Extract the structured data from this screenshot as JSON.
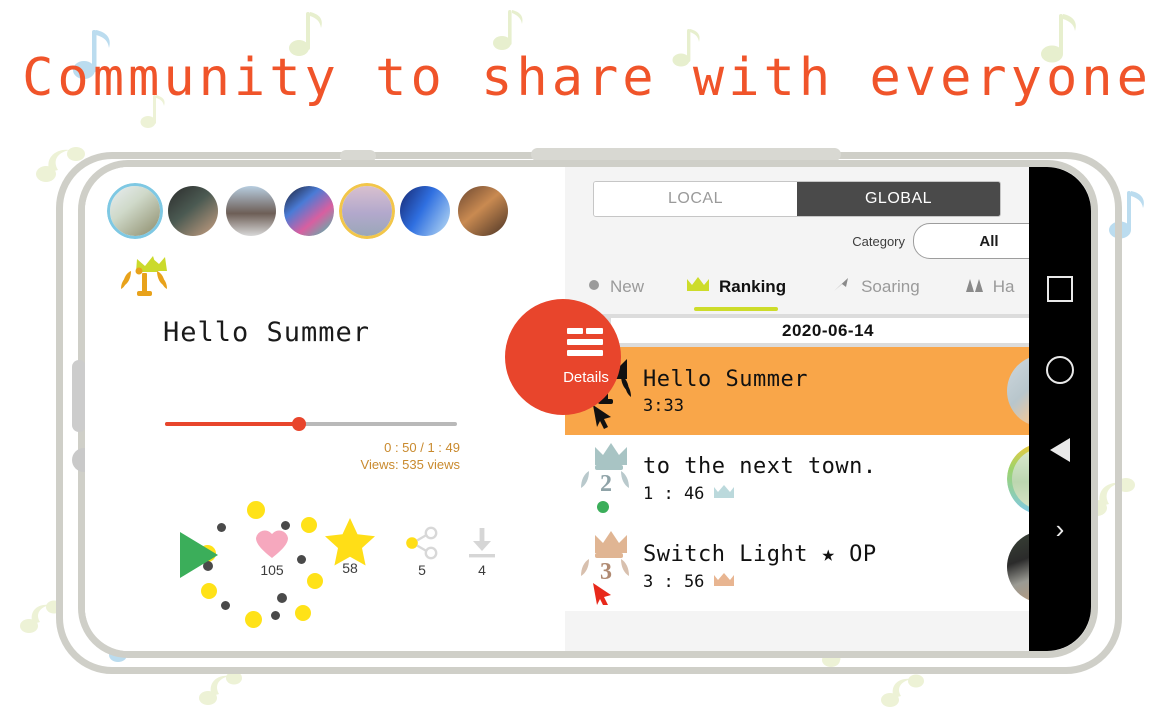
{
  "headline": "Community to share with everyone",
  "theme": {
    "accent_orange": "#F0542A",
    "accent_red": "#E8452C",
    "selected_row": "#F9A649",
    "tab_active_underline": "#CDDC2A",
    "date_button": "#CBD92B",
    "play_green": "#3BAE5A",
    "time_text": "#C98A2E",
    "phone_frame": "#cfcfc8"
  },
  "player": {
    "title": "Hello Summer",
    "progress_percent": 46,
    "time": "0 : 50 / 1 : 49",
    "views": "Views:  535 views",
    "play_icon": "play-triangle-icon",
    "trophy_icon": "crown-laurel-icon",
    "stats": [
      {
        "icon": "heart-icon",
        "count": "105"
      },
      {
        "icon": "star-icon",
        "count": "58"
      },
      {
        "icon": "share-icon",
        "count": "5"
      },
      {
        "icon": "download-icon",
        "count": "4"
      }
    ],
    "stories": [
      {
        "name": "story-avatar-1"
      },
      {
        "name": "story-avatar-2"
      },
      {
        "name": "story-avatar-3"
      },
      {
        "name": "story-avatar-4"
      },
      {
        "name": "story-avatar-5"
      },
      {
        "name": "story-avatar-6"
      },
      {
        "name": "story-avatar-7"
      }
    ]
  },
  "community": {
    "scope_toggle": {
      "local": "LOCAL",
      "global": "GLOBAL",
      "selected": "GLOBAL"
    },
    "category": {
      "label": "Category",
      "value": "All"
    },
    "tabs": [
      {
        "label": "New",
        "icon": "dot-icon",
        "active": false
      },
      {
        "label": "Ranking",
        "icon": "crown-icon",
        "active": true
      },
      {
        "label": "Soaring",
        "icon": "arrow-up-right-icon",
        "active": false
      },
      {
        "label": "Ha",
        "icon": "mountain-icon",
        "active": false
      }
    ],
    "date": {
      "value": "2020-06-14",
      "prev_icon": "prev-day-button",
      "next_icon": "next-day-button"
    },
    "details_button": {
      "label": "Details",
      "icon": "list-lines-icon"
    },
    "rows": [
      {
        "rank": "1",
        "title": "Hello Summer",
        "duration": "3:33",
        "selected": true,
        "badge_icon": "rank1-crown-laurel-icon",
        "cursor_icon": "cursor-arrow-icon",
        "thumb": "thumb-avatar-1"
      },
      {
        "rank": "2",
        "title": "to the next town.",
        "duration": "1 : 46",
        "selected": false,
        "badge_icon": "rank2-crown-laurel-icon",
        "crown_icon": "crown-small-icon",
        "status_icon": "green-dot-icon",
        "thumb": "thumb-avatar-2"
      },
      {
        "rank": "3",
        "title": "Switch Light ★ OP",
        "duration": "3 : 56",
        "selected": false,
        "badge_icon": "rank3-crown-laurel-icon",
        "crown_icon": "crown-small-icon",
        "cursor_icon": "red-cursor-arrow-icon",
        "thumb": "thumb-avatar-3"
      }
    ]
  },
  "android_nav": {
    "recents": "recents-square-icon",
    "home": "home-circle-icon",
    "back": "back-triangle-icon",
    "more": "chevron-right-icon"
  }
}
